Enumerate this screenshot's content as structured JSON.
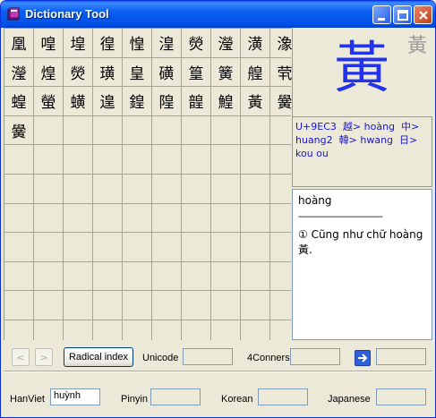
{
  "window": {
    "title": "Dictionary Tool",
    "title_bar_color": "#0a5ff1"
  },
  "character_grid": {
    "cells": [
      "凰",
      "喤",
      "堭",
      "徨",
      "惶",
      "湟",
      "熒",
      "瀅",
      "潢",
      "潒",
      "瀅",
      "煌",
      "熒",
      "璜",
      "皇",
      "磺",
      "篁",
      "簧",
      "艎",
      "茕",
      "蝗",
      "螢",
      "蟥",
      "遑",
      "鍠",
      "隍",
      "韹",
      "鰉",
      "黃",
      "黌",
      "黌"
    ],
    "total_cells": 110
  },
  "selected": {
    "big_char": "黃",
    "small_char": "黃",
    "big_char_color": "#2233ee",
    "info": {
      "codepoint": "U+9EC3",
      "viet_prefix": "越>",
      "viet_reading": "hoàng",
      "zh_prefix": "中>",
      "zh_reading": "huang2",
      "ko_prefix": "韓>",
      "ko_reading": "hwang",
      "ja_prefix": "日>",
      "ja_reading": "kou ou"
    },
    "definition": {
      "headword": "hoàng",
      "separator": "------------------------------------",
      "text": "① Cũng như chữ hoàng 黃."
    }
  },
  "toolbar": {
    "prev_label": "<",
    "next_label": ">",
    "radical_button": "Radical index",
    "unicode_label": "Unicode",
    "unicode_value": "",
    "fourcorners_label": "4Conners",
    "fourcorners_value": "",
    "go_icon": "arrow-right-icon",
    "go_value": ""
  },
  "lookup": {
    "hanviet_label": "HanViet",
    "hanviet_value": "huỳnh",
    "pinyin_label": "Pinyin",
    "pinyin_value": "",
    "korean_label": "Korean",
    "korean_value": "",
    "japanese_label": "Japanese",
    "japanese_value": ""
  }
}
